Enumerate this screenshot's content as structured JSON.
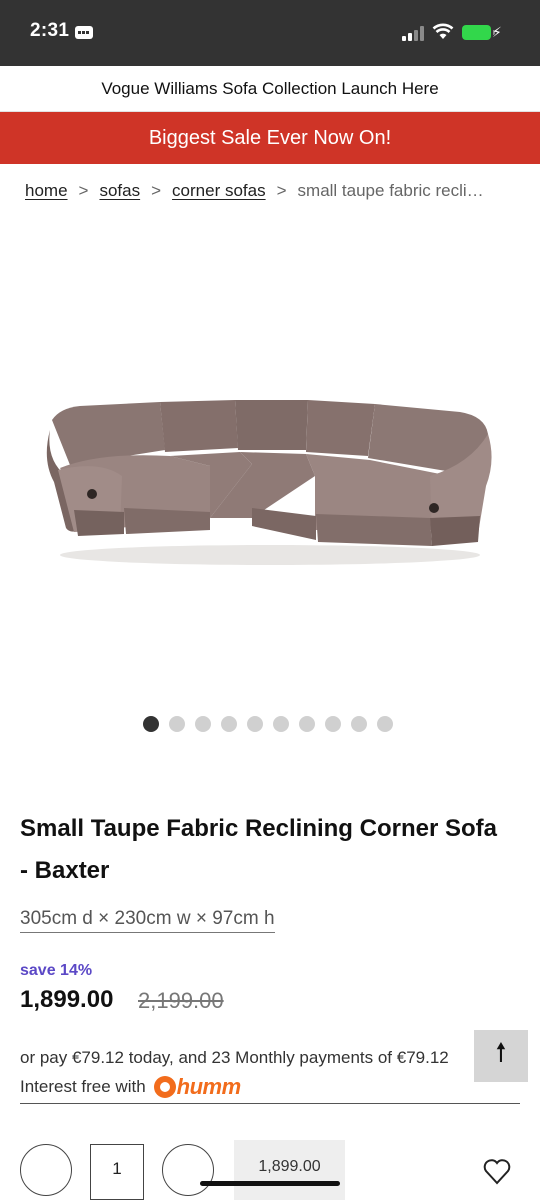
{
  "status_bar": {
    "time": "2:31",
    "icons": [
      "app-badge-icon",
      "signal-icon",
      "wifi-icon",
      "battery-icon",
      "charging-bolt-icon"
    ]
  },
  "promo": {
    "top_text": "Vogue Williams Sofa Collection Launch Here",
    "sale_text": "Biggest Sale Ever Now On!",
    "sale_color": "#cf3427"
  },
  "breadcrumb": {
    "items": [
      {
        "label": "home"
      },
      {
        "label": "sofas"
      },
      {
        "label": "corner sofas"
      }
    ],
    "separator": ">",
    "current": "small taupe fabric recli…"
  },
  "carousel": {
    "total": 10,
    "active_index": 0
  },
  "product": {
    "title": "Small Taupe Fabric Reclining Corner Sofa - Baxter",
    "dimensions": "305cm d × 230cm w × 97cm h",
    "save_label": "save 14%",
    "price": "1,899.00",
    "was_price": "2,199.00",
    "save_color": "#5b48c6"
  },
  "finance": {
    "line1": "or pay €79.12 today, and 23 Monthly payments of €79.12",
    "line2": "Interest free with",
    "provider": "humm",
    "provider_color": "#f26c1c"
  },
  "controls": {
    "back_to_top_icon": "arrow-up-icon",
    "quantity": "1",
    "add_to_cart_label": "1,899.00",
    "wishlist_icon": "heart-icon"
  }
}
